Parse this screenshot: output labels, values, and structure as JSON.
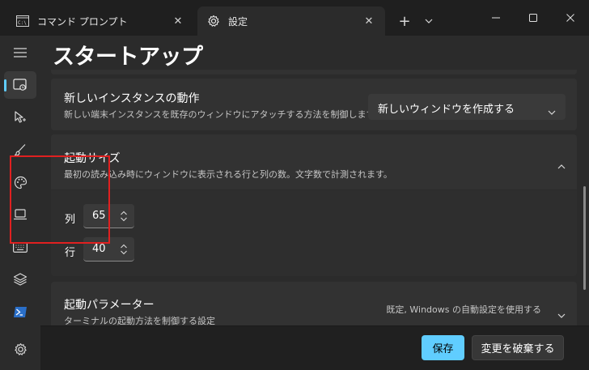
{
  "tabs": [
    {
      "label": "コマンド プロンプト",
      "icon": "command-prompt-icon",
      "close_glyph": "✕",
      "active": false
    },
    {
      "label": "設定",
      "icon": "gear-icon",
      "close_glyph": "✕",
      "active": true
    }
  ],
  "tabbar": {
    "new_tab_glyph": "+",
    "dropdown_icon": "chevron-down-icon"
  },
  "window_controls": [
    "minimize-icon",
    "maximize-icon",
    "close-icon"
  ],
  "nav_rail": {
    "items": [
      "hamburger-menu-icon",
      "startup-icon",
      "interaction-icon",
      "appearance-icon",
      "color-schemes-icon",
      "rendering-icon",
      "actions-icon",
      "profile-defaults-icon",
      "powershell-icon"
    ],
    "selected": "startup-icon",
    "footer_item": "settings-gear-icon"
  },
  "page": {
    "title": "スタートアップ"
  },
  "new_instance": {
    "title": "新しいインスタンスの動作",
    "description": "新しい端末インスタンスを既存のウィンドウにアタッチする方法を制御します。",
    "selected_value": "新しいウィンドウを作成する"
  },
  "launch_size": {
    "title": "起動サイズ",
    "description": "最初の読み込み時にウィンドウに表示される行と列の数。文字数で計測されます。",
    "columns_label": "列",
    "columns_value": "65",
    "rows_label": "行",
    "rows_value": "40"
  },
  "launch_parameters": {
    "title": "起動パラメーター",
    "description": "ターミナルの起動方法を制御する設定",
    "value": "既定, Windows の自動設定を使用する"
  },
  "footer": {
    "save_label": "保存",
    "discard_label": "変更を破棄する"
  },
  "colors": {
    "accent": "#60cdff",
    "highlight_border": "#e02020",
    "background": "#2b2b2b",
    "card": "#323232"
  }
}
